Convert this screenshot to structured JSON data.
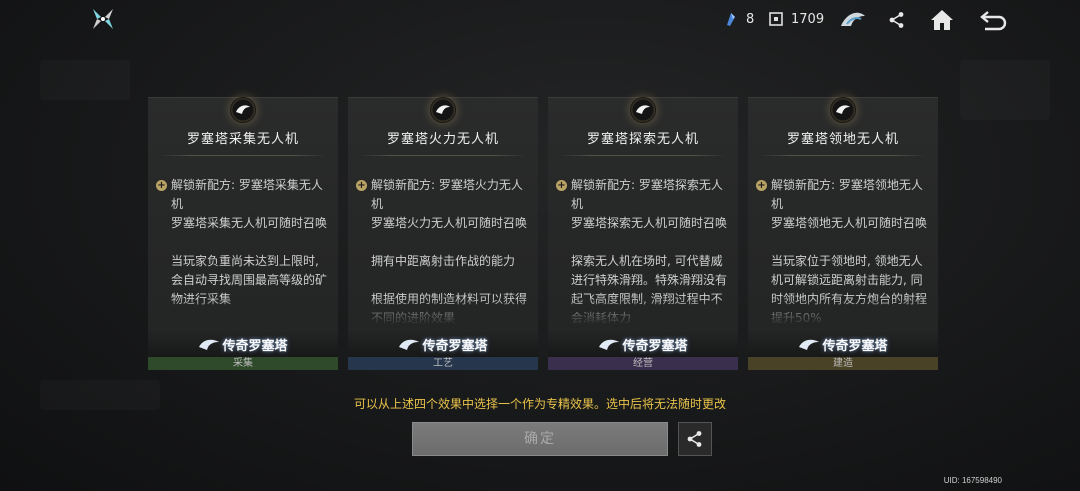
{
  "topbar": {
    "resources": [
      {
        "icon": "blue-crystal-icon",
        "value": "8"
      },
      {
        "icon": "chip-icon",
        "value": "1709"
      }
    ]
  },
  "cards": [
    {
      "title": "罗塞塔采集无人机",
      "unlock": "解锁新配方: 罗塞塔采集无人机",
      "summon": "罗塞塔采集无人机可随时召唤",
      "paragraphs": [
        "当玩家负重尚未达到上限时, 会自动寻找周围最高等级的矿物进行采集"
      ],
      "badge": "传奇罗塞塔",
      "tag": "采集",
      "tag_color": "#2f4a2a"
    },
    {
      "title": "罗塞塔火力无人机",
      "unlock": "解锁新配方: 罗塞塔火力无人机",
      "summon": "罗塞塔火力无人机可随时召唤",
      "paragraphs": [
        "拥有中距离射击作战的能力",
        "根据使用的制造材料可以获得不同的进阶效果"
      ],
      "badge": "传奇罗塞塔",
      "tag": "工艺",
      "tag_color": "#26364d"
    },
    {
      "title": "罗塞塔探索无人机",
      "unlock": "解锁新配方: 罗塞塔探索无人机",
      "summon": "罗塞塔探索无人机可随时召唤",
      "paragraphs": [
        "探索无人机在场时, 可代替威进行特殊滑翔。特殊滑翔没有起飞高度限制, 滑翔过程中不会消耗体力"
      ],
      "badge": "传奇罗塞塔",
      "tag": "经营",
      "tag_color": "#3a2f4d"
    },
    {
      "title": "罗塞塔领地无人机",
      "unlock": "解锁新配方: 罗塞塔领地无人机",
      "summon": "罗塞塔领地无人机可随时召唤",
      "paragraphs": [
        "当玩家位于领地时, 领地无人机可解锁远距离射击能力, 同时领地内所有友方炮台的射程提升50%"
      ],
      "badge": "传奇罗塞塔",
      "tag": "建造",
      "tag_color": "#4a4226"
    }
  ],
  "notice": "可以从上述四个效果中选择一个作为专精效果。选中后将无法随时更改",
  "confirm_label": "确定",
  "uid": "UID: 167598490"
}
